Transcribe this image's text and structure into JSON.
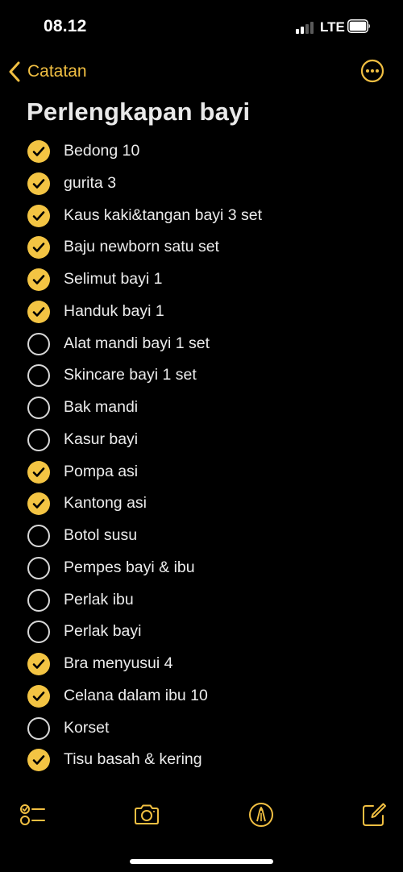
{
  "status_bar": {
    "time": "08.12",
    "network": "LTE"
  },
  "nav": {
    "back_label": "Catatan"
  },
  "note": {
    "title": "Perlengkapan bayi",
    "items": [
      {
        "text": "Bedong 10",
        "checked": true
      },
      {
        "text": "gurita 3",
        "checked": true
      },
      {
        "text": "Kaus kaki&tangan bayi 3 set",
        "checked": true
      },
      {
        "text": "Baju newborn satu set",
        "checked": true
      },
      {
        "text": "Selimut bayi 1",
        "checked": true
      },
      {
        "text": "Handuk bayi 1",
        "checked": true
      },
      {
        "text": "Alat mandi bayi 1 set",
        "checked": false
      },
      {
        "text": "Skincare bayi 1 set",
        "checked": false
      },
      {
        "text": "Bak mandi",
        "checked": false
      },
      {
        "text": "Kasur bayi",
        "checked": false
      },
      {
        "text": "Pompa asi",
        "checked": true
      },
      {
        "text": "Kantong asi",
        "checked": true
      },
      {
        "text": "Botol susu",
        "checked": false
      },
      {
        "text": "Pempes bayi & ibu",
        "checked": false
      },
      {
        "text": "Perlak ibu",
        "checked": false
      },
      {
        "text": "Perlak bayi",
        "checked": false
      },
      {
        "text": "Bra menyusui 4",
        "checked": true
      },
      {
        "text": "Celana dalam ibu 10",
        "checked": true
      },
      {
        "text": "Korset",
        "checked": false
      },
      {
        "text": "Tisu basah & kering",
        "checked": true
      }
    ]
  },
  "toolbar": {
    "icons": [
      "checklist-icon",
      "camera-icon",
      "markup-pen-icon",
      "compose-icon"
    ]
  },
  "colors": {
    "accent": "#f3c443",
    "background": "#000000",
    "text": "#ececec"
  }
}
